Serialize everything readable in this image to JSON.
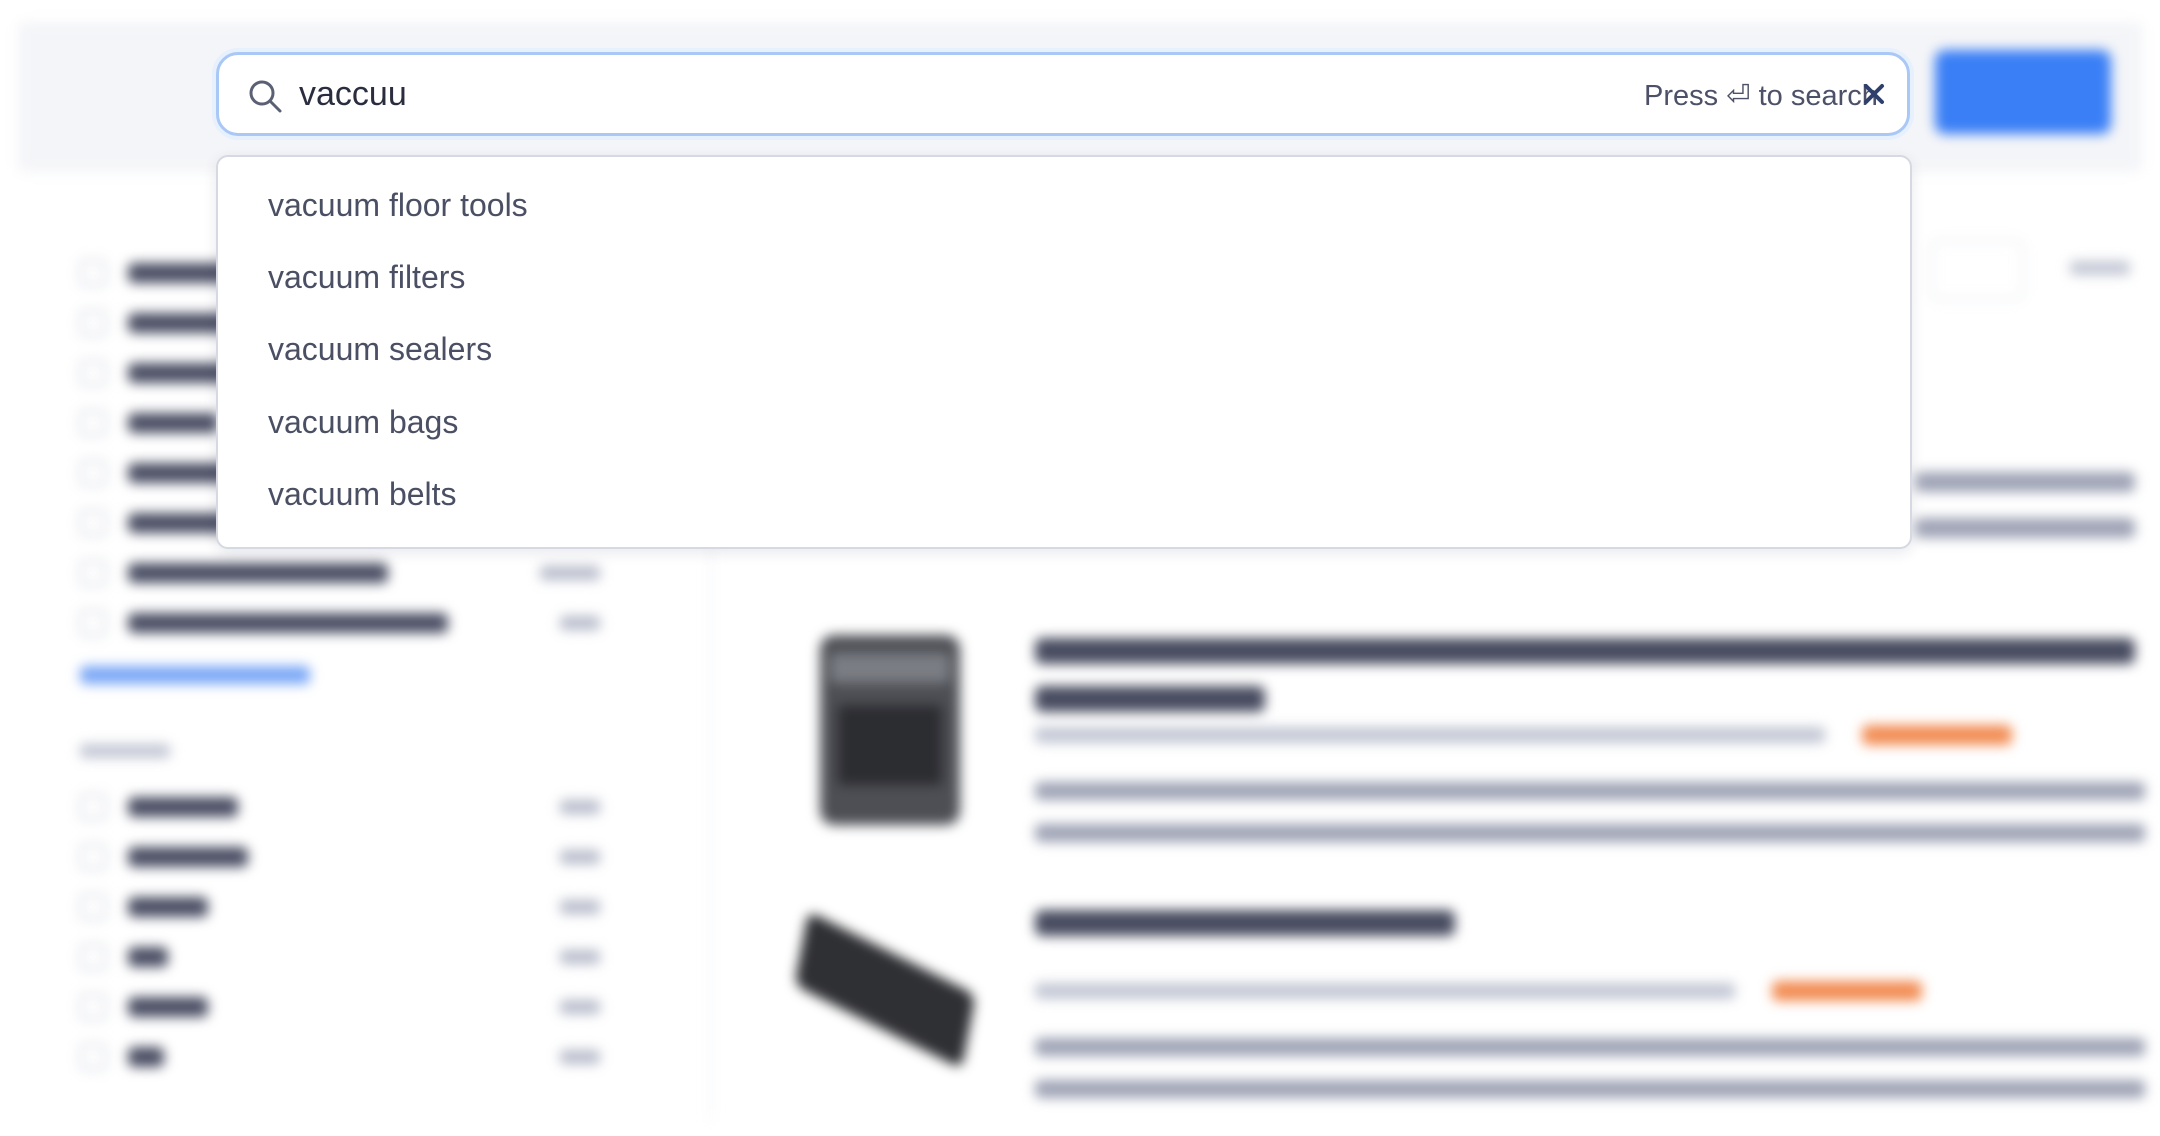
{
  "search": {
    "value": "vaccuu",
    "hint_prefix": "Press",
    "enter_glyph": "⏎",
    "hint_suffix": "to search"
  },
  "suggestions": [
    "vacuum floor tools",
    "vacuum filters",
    "vacuum sealers",
    "vacuum bags",
    "vacuum belts"
  ],
  "colors": {
    "accent": "#3a7ff6",
    "focus_ring": "#a9c8f6",
    "star": "#f28d54"
  }
}
